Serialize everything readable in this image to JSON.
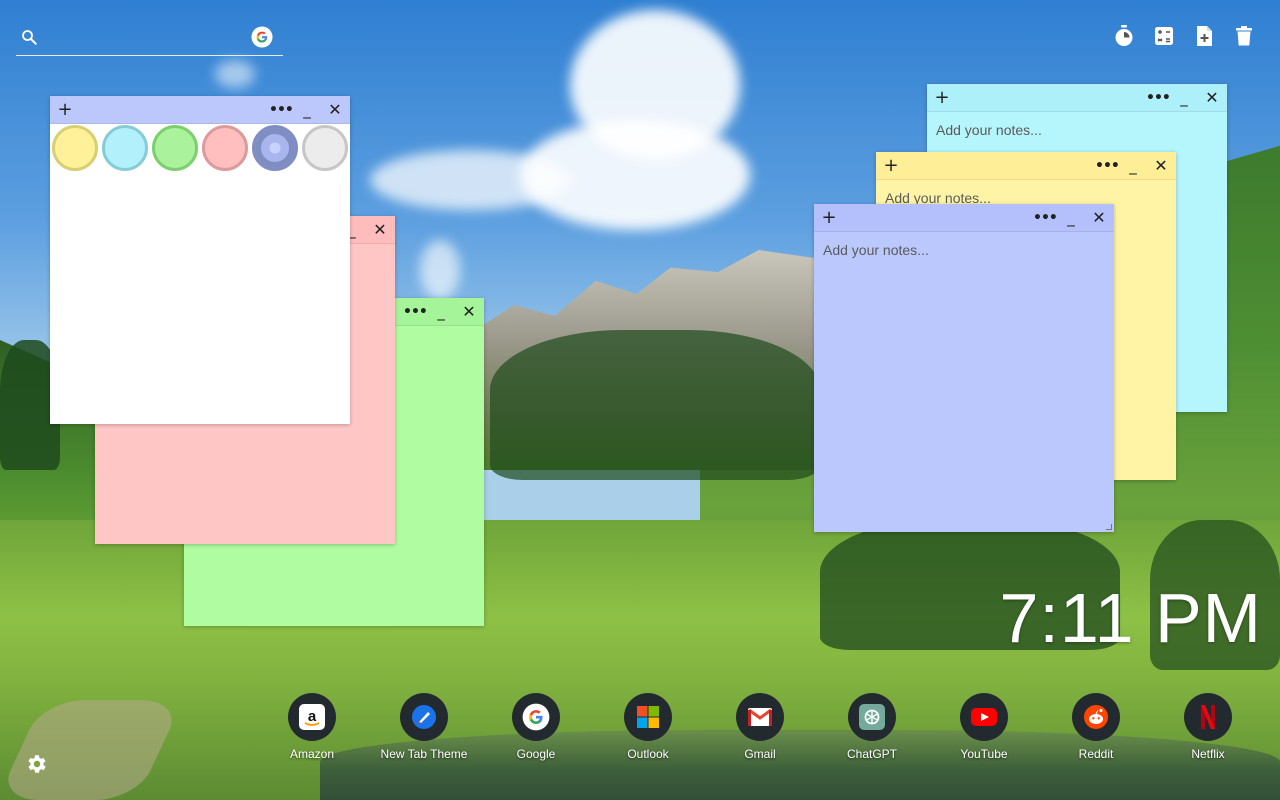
{
  "search": {
    "placeholder": ""
  },
  "toolbar": {
    "items": [
      {
        "name": "timer-icon"
      },
      {
        "name": "calculator-icon"
      },
      {
        "name": "new-note-icon"
      },
      {
        "name": "trash-icon"
      }
    ]
  },
  "notes": {
    "placeholder": "Add your notes...",
    "add_symbol": "+",
    "more_symbol": "•••",
    "minimize_symbol": "_",
    "close_symbol": "✕",
    "colors": {
      "white": "#ffffff",
      "pink": "#ffc6c6",
      "green": "#b0fca0",
      "cyan": "#b5f5fc",
      "yellow": "#fff4a6",
      "periwinkle": "#bac8fd"
    },
    "header_colors": {
      "white_note": "#bcc8fb",
      "pink": "#ffbcbc",
      "green": "#a6f49a",
      "cyan": "#aef0fa",
      "yellow": "#fdee97",
      "periwinkle": "#b3c0fb"
    }
  },
  "color_picker": {
    "swatches": [
      {
        "name": "yellow",
        "fill": "#fff19a",
        "ring": "#d8cf72"
      },
      {
        "name": "cyan",
        "fill": "#b2f1fb",
        "ring": "#86ccd8"
      },
      {
        "name": "green",
        "fill": "#aaf29c",
        "ring": "#7ccf6f"
      },
      {
        "name": "pink",
        "fill": "#ffbfbf",
        "ring": "#dc9a9a"
      },
      {
        "name": "periwinkle",
        "fill": "#a9b6ee",
        "ring": "#7f8dc2",
        "selected": true
      },
      {
        "name": "gray",
        "fill": "#ececec",
        "ring": "#c6c6c6"
      }
    ]
  },
  "clock": {
    "time": "7:11 PM"
  },
  "dock": {
    "items": [
      {
        "label": "Amazon",
        "icon": "amazon-icon"
      },
      {
        "label": "New Tab Theme",
        "icon": "new-tab-theme-icon"
      },
      {
        "label": "Google",
        "icon": "google-icon"
      },
      {
        "label": "Outlook",
        "icon": "outlook-icon"
      },
      {
        "label": "Gmail",
        "icon": "gmail-icon"
      },
      {
        "label": "ChatGPT",
        "icon": "chatgpt-icon"
      },
      {
        "label": "YouTube",
        "icon": "youtube-icon"
      },
      {
        "label": "Reddit",
        "icon": "reddit-icon"
      },
      {
        "label": "Netflix",
        "icon": "netflix-icon"
      }
    ]
  },
  "settings": {
    "icon": "gear-icon"
  }
}
